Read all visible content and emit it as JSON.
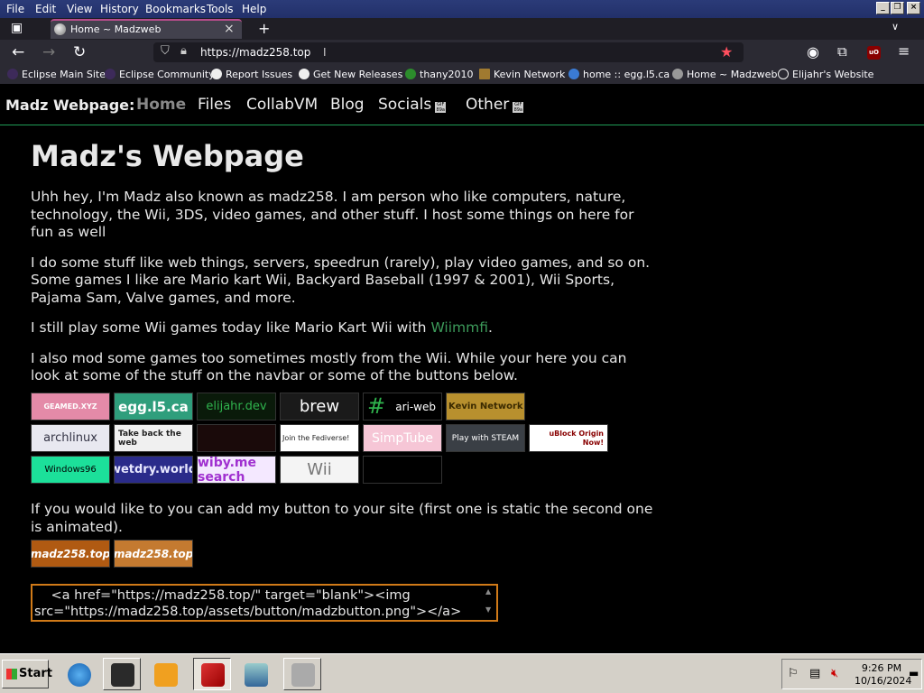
{
  "menubar": {
    "items": [
      "File",
      "Edit",
      "View",
      "History",
      "Bookmarks",
      "Tools",
      "Help"
    ]
  },
  "tab": {
    "title": "Home ~ Madzweb",
    "close": "×",
    "new": "+",
    "list": "∨"
  },
  "nav": {
    "url": "https://madz258.top"
  },
  "bookmarks": [
    "Eclipse Main Site",
    "Eclipse Community",
    "Report Issues",
    "Get New Releases",
    "thany2010",
    "Kevin Network",
    "home :: egg.l5.ca",
    "Home ~ Madzweb",
    "Elijahr's Website"
  ],
  "site": {
    "brand": "Madz Webpage:",
    "links": [
      "Home",
      "Files",
      "CollabVM",
      "Blog",
      "Socials",
      "Other"
    ],
    "gif_badge": "GIF 89a"
  },
  "content": {
    "title": "Madz's Webpage",
    "p1": "Uhh hey, I'm Madz also known as madz258. I am person who like computers, nature, technology, the Wii, 3DS, video games, and other stuff. I host some things on here for fun as well",
    "p2": "I do some stuff like web things, servers, speedrun (rarely), play video games, and so on. Some games I like are Mario kart Wii, Backyard Baseball (1997 & 2001), Wii Sports, Pajama Sam, Valve games, and more.",
    "p3_before": "I still play some Wii games today like Mario Kart Wii with ",
    "p3_link": "Wiimmfi",
    "p3_after": ".",
    "p4": "I also mod some games too sometimes mostly from the Wii. While your here you can look at some of the stuff on the navbar or some of the buttons below.",
    "add_text": "If you would like to you can add my button to your site (first one is static the second one is animated).",
    "code": "    <a href=\"https://madz258.top/\" target=\"blank\"><img src=\"https://madz258.top/assets/button/madzbutton.png\"></a>"
  },
  "buttons": {
    "row1": [
      "GEAMED.XYZ",
      "egg.l5.ca",
      "elijahr.dev",
      "brew",
      "ari-web",
      "Kevin Network"
    ],
    "row2": [
      "archlinux",
      "Take back the web",
      "",
      "Join the Fediverse!",
      "SimpTube",
      "Play with STEAM",
      "uBlock Origin Now!"
    ],
    "row3": [
      "Windows96",
      "wetdry.world",
      "wiby.me search",
      "Wii",
      ""
    ],
    "mine": [
      "madz258.top",
      "madz258.top"
    ]
  },
  "taskbar": {
    "start": "Start",
    "time": "9:26 PM",
    "date": "10/16/2024"
  }
}
